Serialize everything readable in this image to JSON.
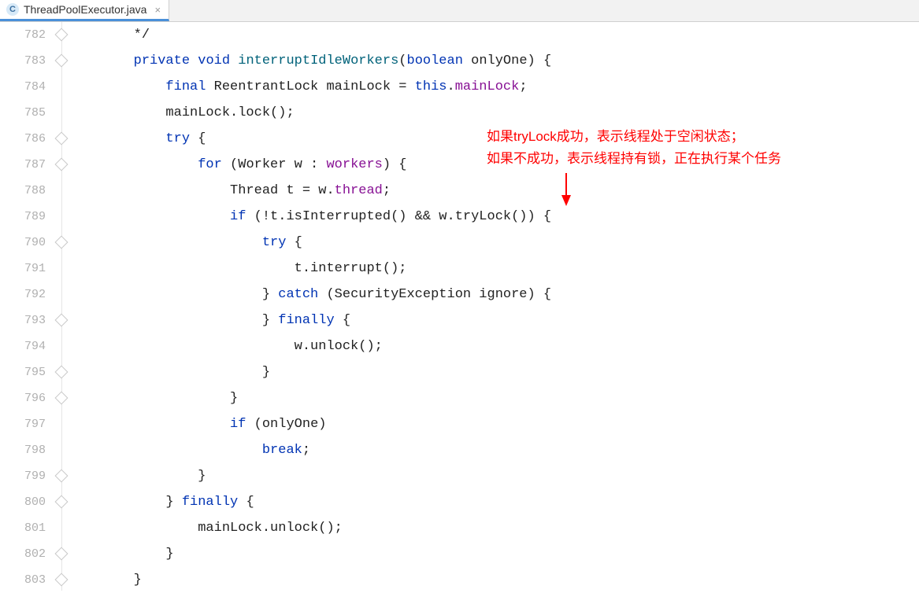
{
  "tab": {
    "filename": "ThreadPoolExecutor.java",
    "icon_letter": "C"
  },
  "gutter": {
    "start": 782,
    "end": 803
  },
  "code_lines": [
    [
      {
        "t": "txt",
        "s": "        */"
      }
    ],
    [
      {
        "t": "txt",
        "s": "        "
      },
      {
        "t": "kw",
        "s": "private void "
      },
      {
        "t": "decl",
        "s": "interruptIdleWorkers"
      },
      {
        "t": "txt",
        "s": "("
      },
      {
        "t": "kw",
        "s": "boolean"
      },
      {
        "t": "txt",
        "s": " onlyOne) {"
      }
    ],
    [
      {
        "t": "txt",
        "s": "            "
      },
      {
        "t": "kw",
        "s": "final"
      },
      {
        "t": "txt",
        "s": " ReentrantLock mainLock = "
      },
      {
        "t": "kw",
        "s": "this"
      },
      {
        "t": "txt",
        "s": "."
      },
      {
        "t": "field",
        "s": "mainLock"
      },
      {
        "t": "txt",
        "s": ";"
      }
    ],
    [
      {
        "t": "txt",
        "s": "            mainLock.lock();"
      }
    ],
    [
      {
        "t": "txt",
        "s": "            "
      },
      {
        "t": "kw",
        "s": "try"
      },
      {
        "t": "txt",
        "s": " {"
      }
    ],
    [
      {
        "t": "txt",
        "s": "                "
      },
      {
        "t": "kw",
        "s": "for"
      },
      {
        "t": "txt",
        "s": " (Worker w : "
      },
      {
        "t": "field",
        "s": "workers"
      },
      {
        "t": "txt",
        "s": ") {"
      }
    ],
    [
      {
        "t": "txt",
        "s": "                    Thread t = w."
      },
      {
        "t": "field",
        "s": "thread"
      },
      {
        "t": "txt",
        "s": ";"
      }
    ],
    [
      {
        "t": "txt",
        "s": "                    "
      },
      {
        "t": "kw",
        "s": "if"
      },
      {
        "t": "txt",
        "s": " (!t.isInterrupted() && w.tryLock()) {"
      }
    ],
    [
      {
        "t": "txt",
        "s": "                        "
      },
      {
        "t": "kw",
        "s": "try"
      },
      {
        "t": "txt",
        "s": " {"
      }
    ],
    [
      {
        "t": "txt",
        "s": "                            t.interrupt();"
      }
    ],
    [
      {
        "t": "txt",
        "s": "                        } "
      },
      {
        "t": "kw",
        "s": "catch"
      },
      {
        "t": "txt",
        "s": " (SecurityException ignore) {"
      }
    ],
    [
      {
        "t": "txt",
        "s": "                        } "
      },
      {
        "t": "kw",
        "s": "finally"
      },
      {
        "t": "txt",
        "s": " {"
      }
    ],
    [
      {
        "t": "txt",
        "s": "                            w.unlock();"
      }
    ],
    [
      {
        "t": "txt",
        "s": "                        }"
      }
    ],
    [
      {
        "t": "txt",
        "s": "                    }"
      }
    ],
    [
      {
        "t": "txt",
        "s": "                    "
      },
      {
        "t": "kw",
        "s": "if"
      },
      {
        "t": "txt",
        "s": " (onlyOne)"
      }
    ],
    [
      {
        "t": "txt",
        "s": "                        "
      },
      {
        "t": "kw",
        "s": "break"
      },
      {
        "t": "txt",
        "s": ";"
      }
    ],
    [
      {
        "t": "txt",
        "s": "                }"
      }
    ],
    [
      {
        "t": "txt",
        "s": "            } "
      },
      {
        "t": "kw",
        "s": "finally"
      },
      {
        "t": "txt",
        "s": " {"
      }
    ],
    [
      {
        "t": "txt",
        "s": "                mainLock.unlock();"
      }
    ],
    [
      {
        "t": "txt",
        "s": "            }"
      }
    ],
    [
      {
        "t": "txt",
        "s": "        }"
      }
    ]
  ],
  "annotation": {
    "line1": "如果tryLock成功，表示线程处于空闲状态；",
    "line2": "如果不成功，表示线程持有锁，正在执行某个任务"
  }
}
